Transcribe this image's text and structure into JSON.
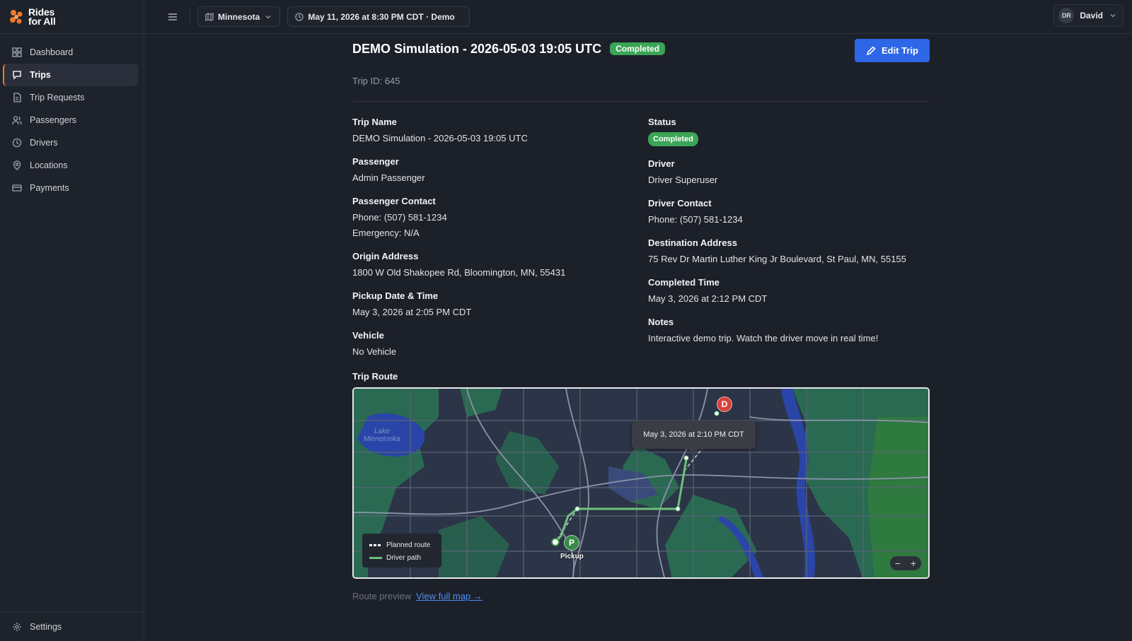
{
  "brand": {
    "line1": "Rides",
    "line2": "for All",
    "accent": "#f07a2a"
  },
  "sidebar": {
    "items": [
      {
        "label": "Dashboard",
        "icon": "grid-icon"
      },
      {
        "label": "Trips",
        "icon": "chat-icon",
        "active": true
      },
      {
        "label": "Trip Requests",
        "icon": "file-icon"
      },
      {
        "label": "Passengers",
        "icon": "users-icon"
      },
      {
        "label": "Drivers",
        "icon": "clock-icon"
      },
      {
        "label": "Locations",
        "icon": "pin-icon"
      },
      {
        "label": "Payments",
        "icon": "card-icon"
      }
    ],
    "settings_label": "Settings"
  },
  "topbar": {
    "region": "Minnesota",
    "datetime": "May 11, 2026 at 8:30 PM CDT · Demo",
    "user_initials": "DR",
    "user_name": "David"
  },
  "trip": {
    "title": "DEMO Simulation - 2026-05-03 19:05 UTC",
    "status_badge": "Completed",
    "edit_label": "Edit Trip",
    "trip_id": "Trip ID: 645",
    "fields_left": [
      {
        "label": "Trip Name",
        "values": [
          "DEMO Simulation - 2026-05-03 19:05 UTC"
        ]
      },
      {
        "label": "Passenger",
        "values": [
          "Admin Passenger"
        ]
      },
      {
        "label": "Passenger Contact",
        "values": [
          "Phone: (507) 581-1234",
          "Emergency: N/A"
        ]
      },
      {
        "label": "Origin Address",
        "values": [
          "1800 W Old Shakopee Rd, Bloomington, MN, 55431"
        ]
      },
      {
        "label": "Pickup Date & Time",
        "values": [
          "May 3, 2026 at 2:05 PM CDT"
        ]
      },
      {
        "label": "Vehicle",
        "values": [
          "No Vehicle"
        ]
      }
    ],
    "fields_right": [
      {
        "label": "Status",
        "badge": "Completed"
      },
      {
        "label": "Driver",
        "values": [
          "Driver Superuser"
        ]
      },
      {
        "label": "Driver Contact",
        "values": [
          "Phone: (507) 581-1234"
        ]
      },
      {
        "label": "Destination Address",
        "values": [
          "75 Rev Dr Martin Luther King Jr Boulevard, St Paul, MN, 55155"
        ]
      },
      {
        "label": "Completed Time",
        "values": [
          "May 3, 2026 at 2:12 PM CDT"
        ]
      },
      {
        "label": "Notes",
        "values": [
          "Interactive demo trip. Watch the driver move in real time!"
        ]
      }
    ],
    "route_label": "Trip Route",
    "map": {
      "tooltip": "May 3, 2026 at 2:10 PM CDT",
      "lake_label_1": "Lake",
      "lake_label_2": "Minnetonka",
      "pickup_marker": "P",
      "pickup_label": "Pickup",
      "destination_marker": "D",
      "legend_planned": "Planned route",
      "legend_driver": "Driver path",
      "zoom_out": "−",
      "zoom_in": "+"
    },
    "route_preview": "Route preview",
    "view_full_map": "View full map →"
  }
}
